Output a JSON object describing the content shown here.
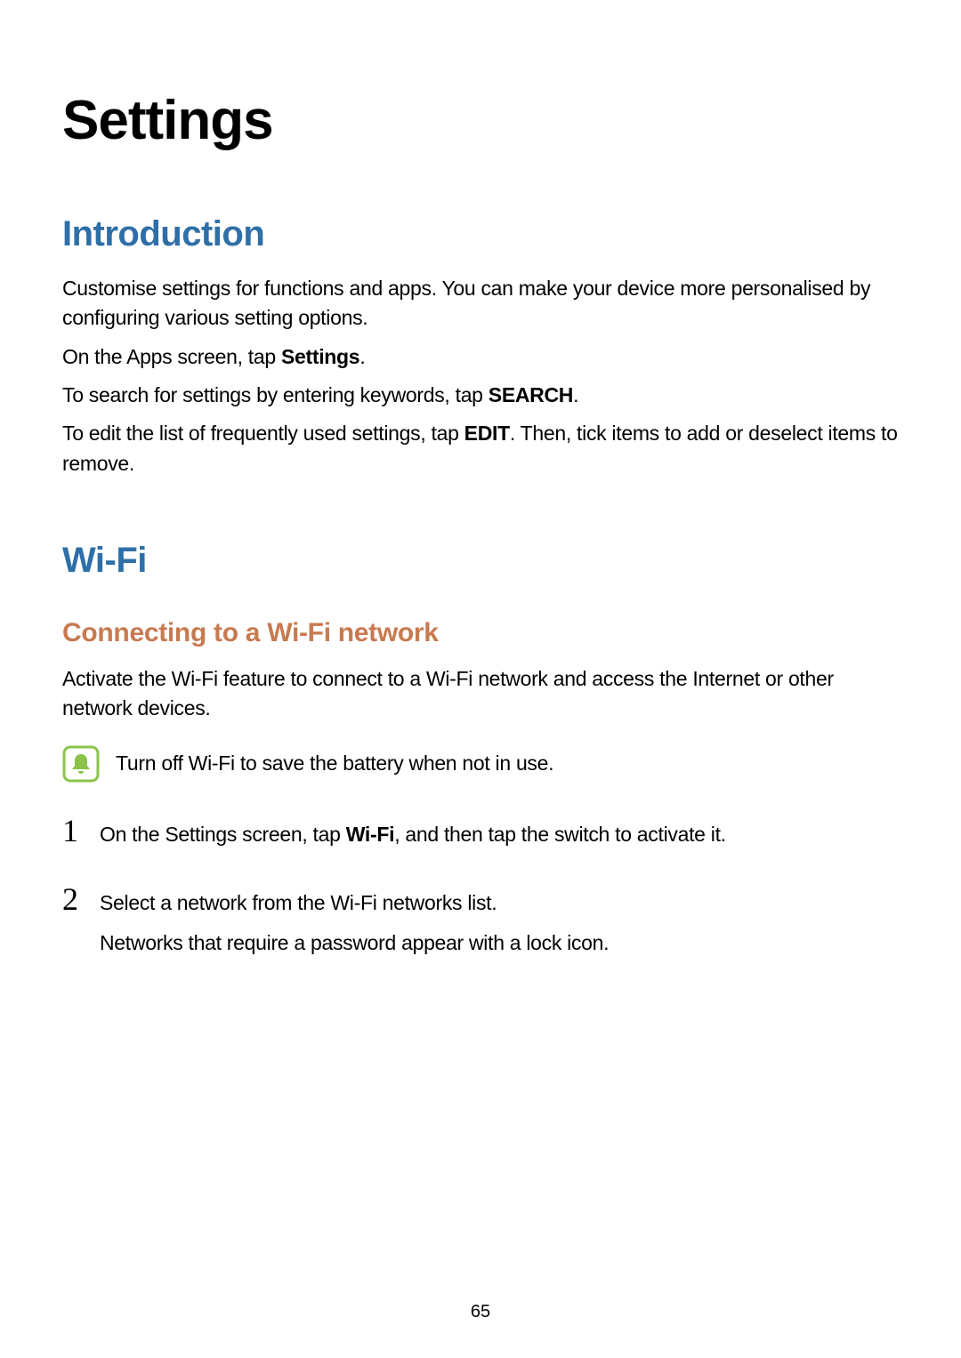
{
  "page": {
    "title": "Settings",
    "pageNumber": "65"
  },
  "intro": {
    "heading": "Introduction",
    "p1": "Customise settings for functions and apps. You can make your device more personalised by configuring various setting options.",
    "p2_pre": "On the Apps screen, tap ",
    "p2_bold": "Settings",
    "p2_post": ".",
    "p3_pre": "To search for settings by entering keywords, tap ",
    "p3_bold": "SEARCH",
    "p3_post": ".",
    "p4_pre": "To edit the list of frequently used settings, tap ",
    "p4_bold": "EDIT",
    "p4_post": ". Then, tick items to add or deselect items to remove."
  },
  "wifi": {
    "heading": "Wi-Fi",
    "subheading": "Connecting to a Wi-Fi network",
    "p1": "Activate the Wi-Fi feature to connect to a Wi-Fi network and access the Internet or other network devices.",
    "note": "Turn off Wi-Fi to save the battery when not in use.",
    "step1_pre": "On the Settings screen, tap ",
    "step1_bold": "Wi-Fi",
    "step1_post": ", and then tap the switch to activate it.",
    "step2_p1": "Select a network from the Wi-Fi networks list.",
    "step2_p2": "Networks that require a password appear with a lock icon."
  },
  "numbers": {
    "one": "1",
    "two": "2"
  }
}
